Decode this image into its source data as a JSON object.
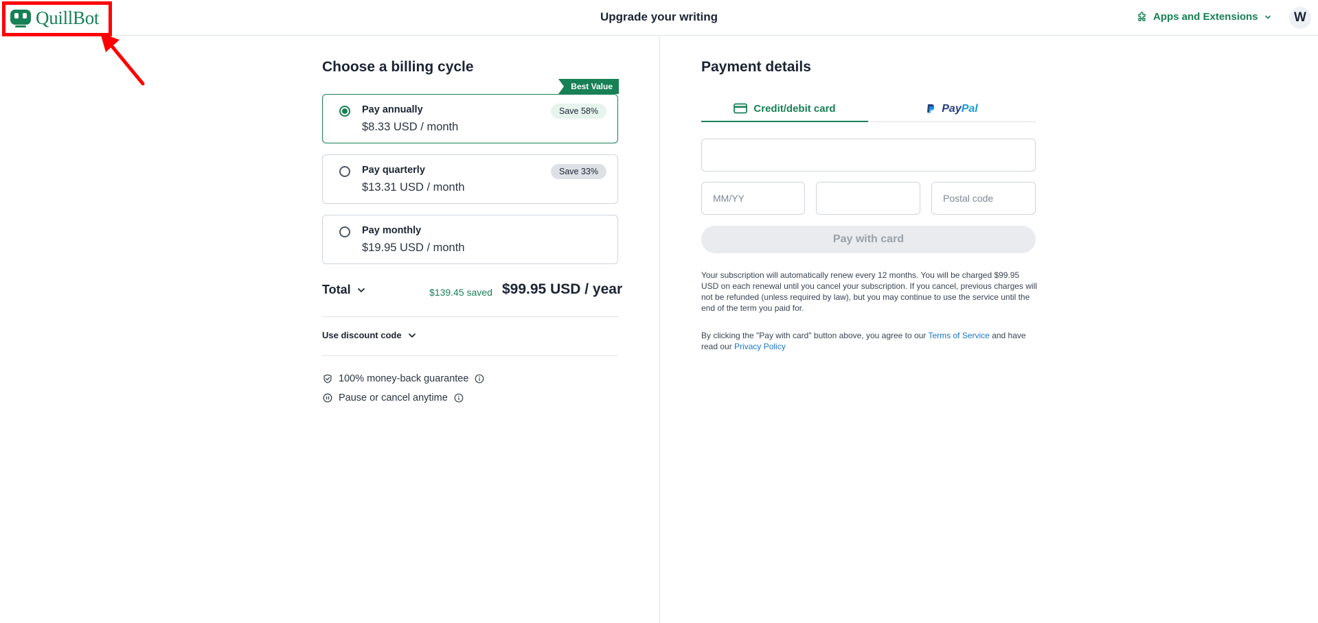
{
  "header": {
    "logo_text": "QuillBot",
    "title": "Upgrade your writing",
    "apps_label": "Apps and Extensions",
    "avatar_initial": "W",
    "accent_color": "#188055",
    "annotation_color": "#ff0000"
  },
  "billing": {
    "title": "Choose a billing cycle",
    "best_value_label": "Best Value",
    "plans": [
      {
        "name": "Pay annually",
        "price": "$8.33 USD / month",
        "badge": "Save 58%",
        "selected": true
      },
      {
        "name": "Pay quarterly",
        "price": "$13.31 USD / month",
        "badge": "Save 33%",
        "selected": false
      },
      {
        "name": "Pay monthly",
        "price": "$19.95 USD / month",
        "badge": "",
        "selected": false
      }
    ],
    "total_label": "Total",
    "saved_text": "$139.45 saved",
    "total_price": "$99.95 USD / year",
    "discount_label": "Use discount code",
    "features": [
      "100% money-back guarantee",
      "Pause or cancel anytime"
    ]
  },
  "payment": {
    "title": "Payment details",
    "tabs": {
      "card": "Credit/debit card",
      "paypal_part1": "Pay",
      "paypal_part2": "Pal"
    },
    "card_number_placeholder": "",
    "expiry_placeholder": "MM/YY",
    "cvc_placeholder": "",
    "postal_placeholder": "Postal code",
    "pay_button": "Pay with card",
    "renewal_notice": "Your subscription will automatically renew every 12 months. You will be charged $99.95 USD on each renewal until you cancel your subscription. If you cancel, previous charges will not be refunded (unless required by law), but you may continue to use the service until the end of the term you paid for.",
    "terms_prefix": "By clicking the \"Pay with card\" button above, you agree to our ",
    "terms_link": "Terms of Service",
    "terms_middle": " and have read our ",
    "privacy_link": "Privacy Policy"
  }
}
